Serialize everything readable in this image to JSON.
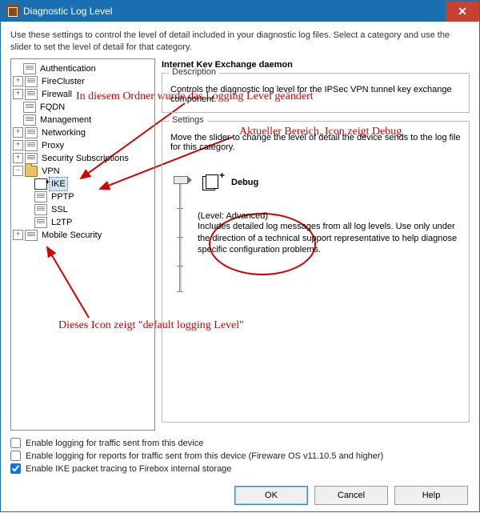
{
  "window": {
    "title": "Diagnostic Log Level",
    "close_glyph": "✕"
  },
  "intro": "Use these settings to control the level of detail included in your diagnostic log files. Select a category and use the slider to set the level of detail for that category.",
  "tree": {
    "items": [
      {
        "label": "Authentication",
        "expander": "",
        "icon": "doc"
      },
      {
        "label": "FireCluster",
        "expander": "+",
        "icon": "doc"
      },
      {
        "label": "Firewall",
        "expander": "+",
        "icon": "doc"
      },
      {
        "label": "FQDN",
        "expander": "",
        "icon": "doc"
      },
      {
        "label": "Management",
        "expander": "",
        "icon": "doc"
      },
      {
        "label": "Networking",
        "expander": "+",
        "icon": "doc"
      },
      {
        "label": "Proxy",
        "expander": "+",
        "icon": "doc"
      },
      {
        "label": "Security Subscriptions",
        "expander": "+",
        "icon": "doc"
      },
      {
        "label": "VPN",
        "expander": "−",
        "icon": "folder",
        "children": [
          {
            "label": "IKE",
            "icon": "debug",
            "selected": true
          },
          {
            "label": "PPTP",
            "icon": "doc"
          },
          {
            "label": "SSL",
            "icon": "doc"
          },
          {
            "label": "L2TP",
            "icon": "doc"
          }
        ]
      },
      {
        "label": "Mobile Security",
        "expander": "+",
        "icon": "doc"
      }
    ]
  },
  "right": {
    "title": "Internet Key Exchange daemon",
    "description_legend": "Description",
    "description_text": "Controls the diagnostic log level for the IPSec VPN tunnel key exchange component.",
    "settings_legend": "Settings",
    "settings_msg": "Move the slider to change the level of detail the device sends to the log file for this category.",
    "level_name": "Debug",
    "level_caption": "(Level: Advanced)",
    "level_desc": "Includes detailed log messages from all log levels. Use only under the direction of a technical support representative to help diagnose specific configuration problems."
  },
  "checks": {
    "c1": "Enable logging for traffic sent from this device",
    "c2": "Enable logging for reports for traffic sent from this device (Fireware OS v11.10.5 and higher)",
    "c3": "Enable IKE packet tracing to Firebox internal storage"
  },
  "buttons": {
    "ok": "OK",
    "cancel": "Cancel",
    "help": "Help"
  },
  "annotations": {
    "a1": "In diesem Ordner wurde das Logging Level geändert",
    "a2": "Aktueller Bereich, Icon zeigt Debug",
    "a3": "Dieses Icon zeigt \"default logging Level\""
  },
  "colors": {
    "accent": "#1a6fb0",
    "close": "#c84031",
    "annotation": "#d40000"
  }
}
